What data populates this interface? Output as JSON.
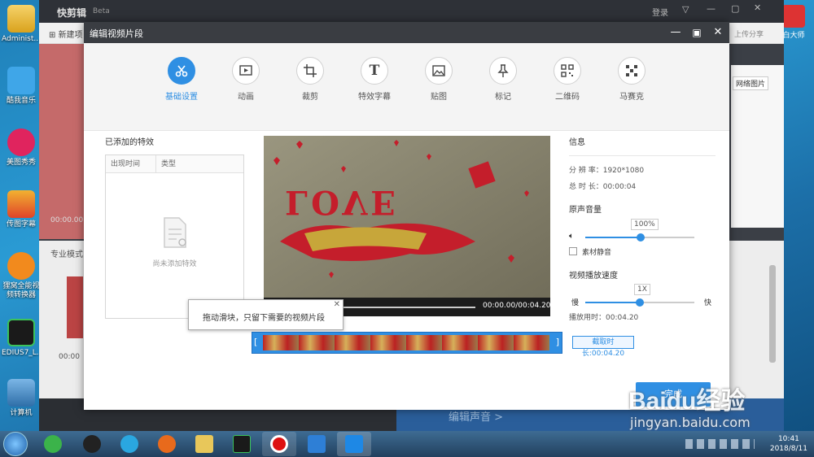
{
  "desktop": {
    "icons": [
      "Administ...",
      "酷我音乐",
      "美图秀秀",
      "传图字幕",
      "狸窝全能视频转换器",
      "EDIUS7_L...",
      "计算机"
    ],
    "right_icon_label": "白大师"
  },
  "bgapp": {
    "title": "快剪辑",
    "beta": "Beta",
    "login": "登录",
    "new_project": "新建项",
    "share": "上传分享",
    "mode": "专业模式",
    "time_left": "00:00.00",
    "time_marker": "00:00",
    "online_images": "网络图片",
    "edit_audio": "编辑声音 >"
  },
  "dialog": {
    "title": "编辑视频片段",
    "tools": [
      "基础设置",
      "动画",
      "裁剪",
      "特效字幕",
      "贴图",
      "标记",
      "二维码",
      "马赛克"
    ],
    "added_effects": "已添加的特效",
    "col_time": "出现时间",
    "col_type": "类型",
    "empty": "尚未添加特效",
    "video_time": "00:00.00/00:04.20",
    "tooltip": "拖动滑块，只留下需要的视频片段",
    "clip_duration": "截取时长:00:04.20",
    "done": "完成",
    "info": {
      "title": "信息",
      "resolution_label": "分 辨 率：",
      "resolution": "1920*1080",
      "duration_label": "总 时 长：",
      "duration": "00:00:04",
      "volume_title": "原声音量",
      "volume": "100%",
      "mute_label": "素材静音",
      "speed_title": "视频播放速度",
      "speed": "1X",
      "slow": "慢",
      "fast": "快",
      "playtime_label": "播放用时：",
      "playtime": "00:04.20"
    },
    "video_text": "LOVE"
  },
  "taskbar": {
    "time": "10:41",
    "date": "2018/8/11"
  },
  "watermark": {
    "brand": "Baidu经验",
    "url": "jingyan.baidu.com"
  },
  "colors": {
    "accent": "#2f8fe3",
    "dialog_title": "#3a3d42"
  }
}
